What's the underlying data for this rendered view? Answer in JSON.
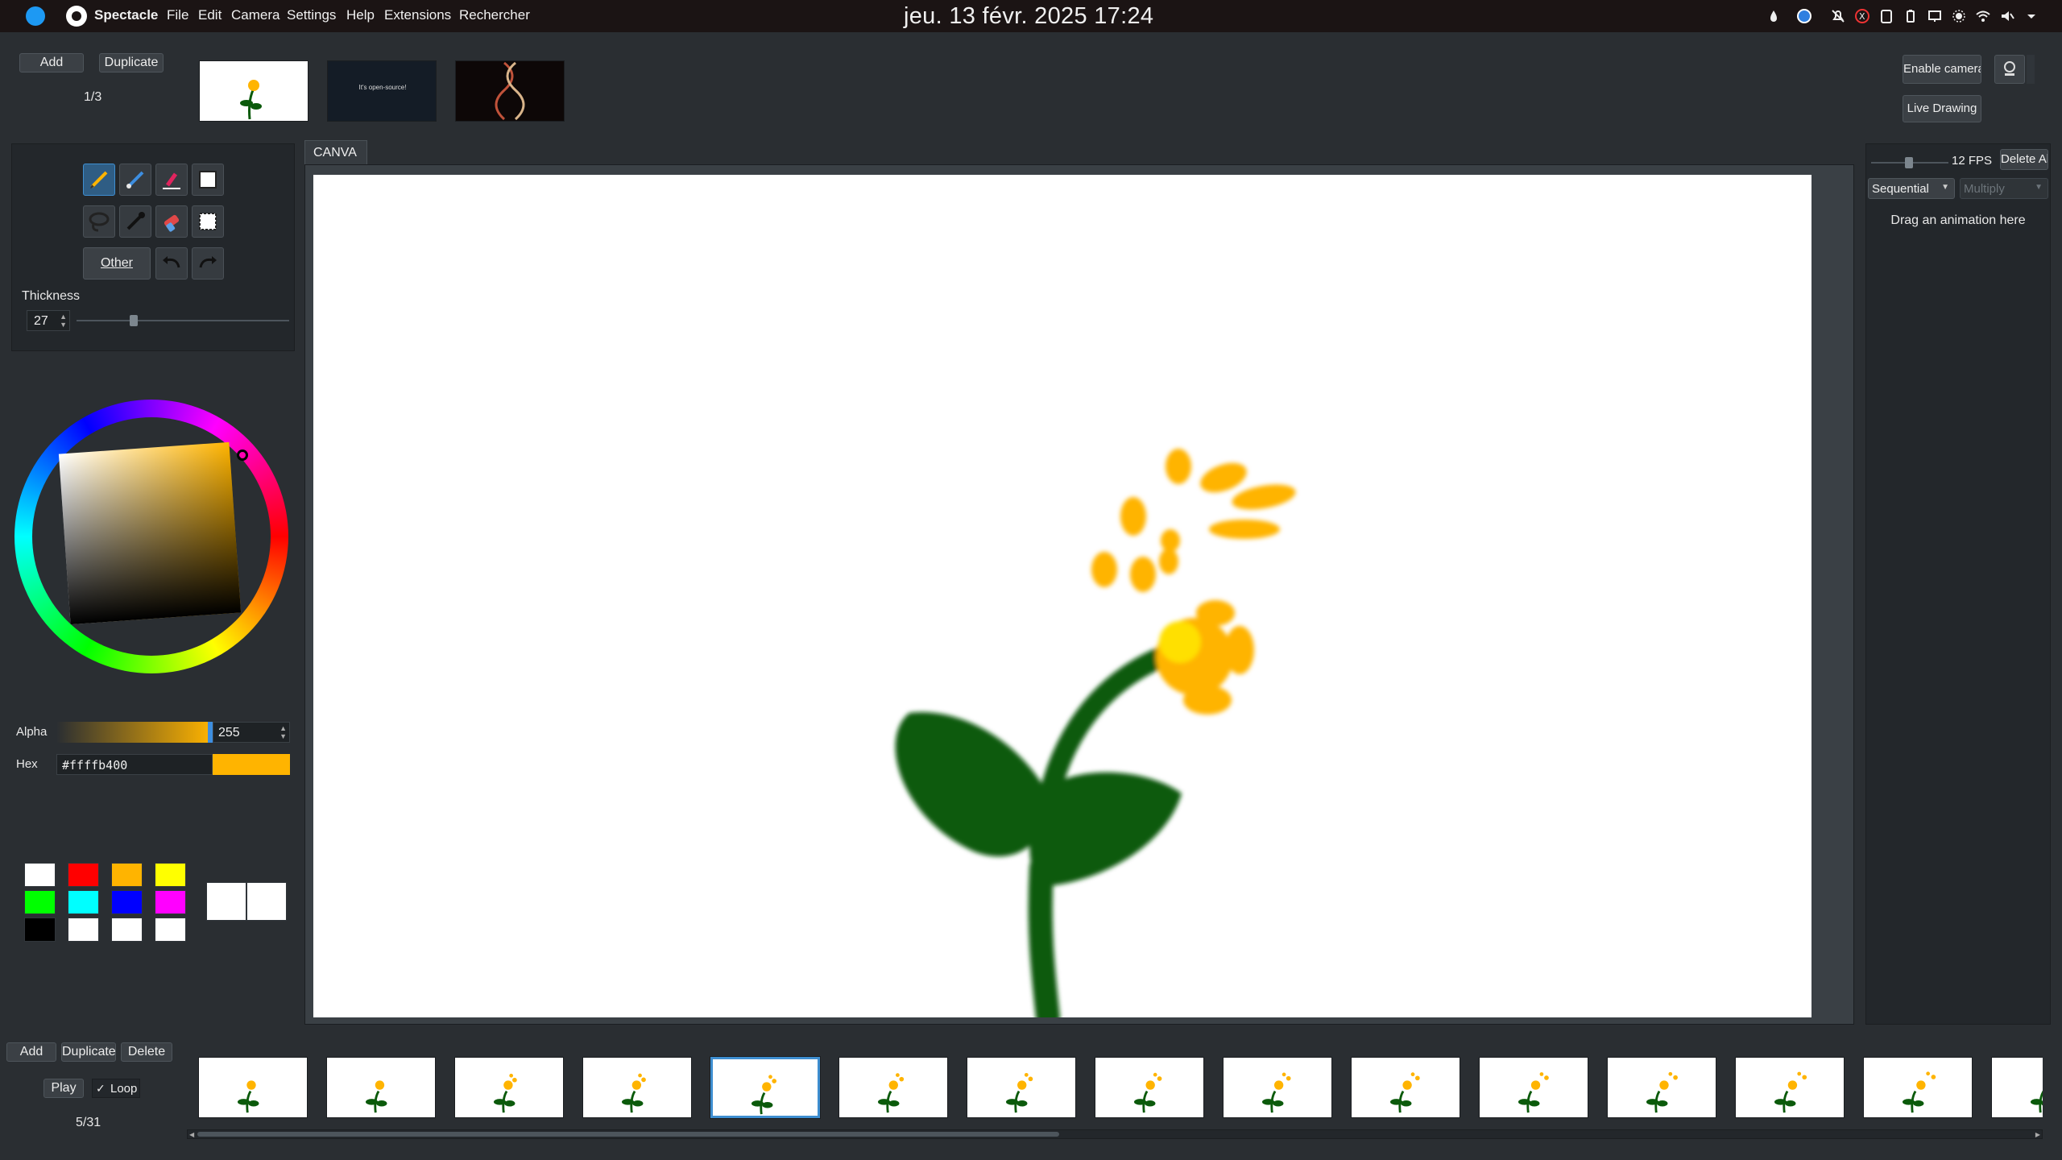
{
  "menubar": {
    "app_name": "Spectacle",
    "menus": [
      "File",
      "Edit",
      "Camera",
      "Settings",
      "Help",
      "Extensions",
      "Rechercher"
    ],
    "clock": "jeu. 13 févr. 2025   17:24"
  },
  "top": {
    "add_label": "Add",
    "duplicate_label": "Duplicate",
    "counter": "1/3",
    "scene_thumbs": [
      "flower",
      "It's open-source!",
      "dna"
    ],
    "enable_camera_label": "Enable camera",
    "live_drawing_label": "Live Drawing"
  },
  "canvas": {
    "tab_label": "CANVA"
  },
  "tools": {
    "other_label": "Other",
    "thickness_label": "Thickness",
    "thickness_value": "27",
    "thickness_fraction": 0.27
  },
  "color": {
    "alpha_label": "Alpha",
    "alpha_value": "255",
    "hex_label": "Hex",
    "hex_value": "#ffffb400",
    "current_color": "#ffb400",
    "palette": [
      "#ffffff",
      "#ff0000",
      "#ffb400",
      "#ffff00",
      "#00ff00",
      "#00ffff",
      "#0000ff",
      "#ff00ff",
      "#000000",
      "#ffffff",
      "#ffffff",
      "#ffffff"
    ]
  },
  "right_panel": {
    "fps_label": "12 FPS",
    "delete_all_label": "Delete All",
    "mode_select": "Sequential",
    "blend_select": "Multiply",
    "drop_hint": "Drag an animation here"
  },
  "bottom": {
    "add_label": "Add",
    "duplicate_label": "Duplicate",
    "delete_label": "Delete",
    "play_label": "Play",
    "loop_label": "Loop",
    "loop_checked": true,
    "frame_counter": "5/31",
    "selected_frame_index": 4,
    "frame_count_visible": 15
  }
}
